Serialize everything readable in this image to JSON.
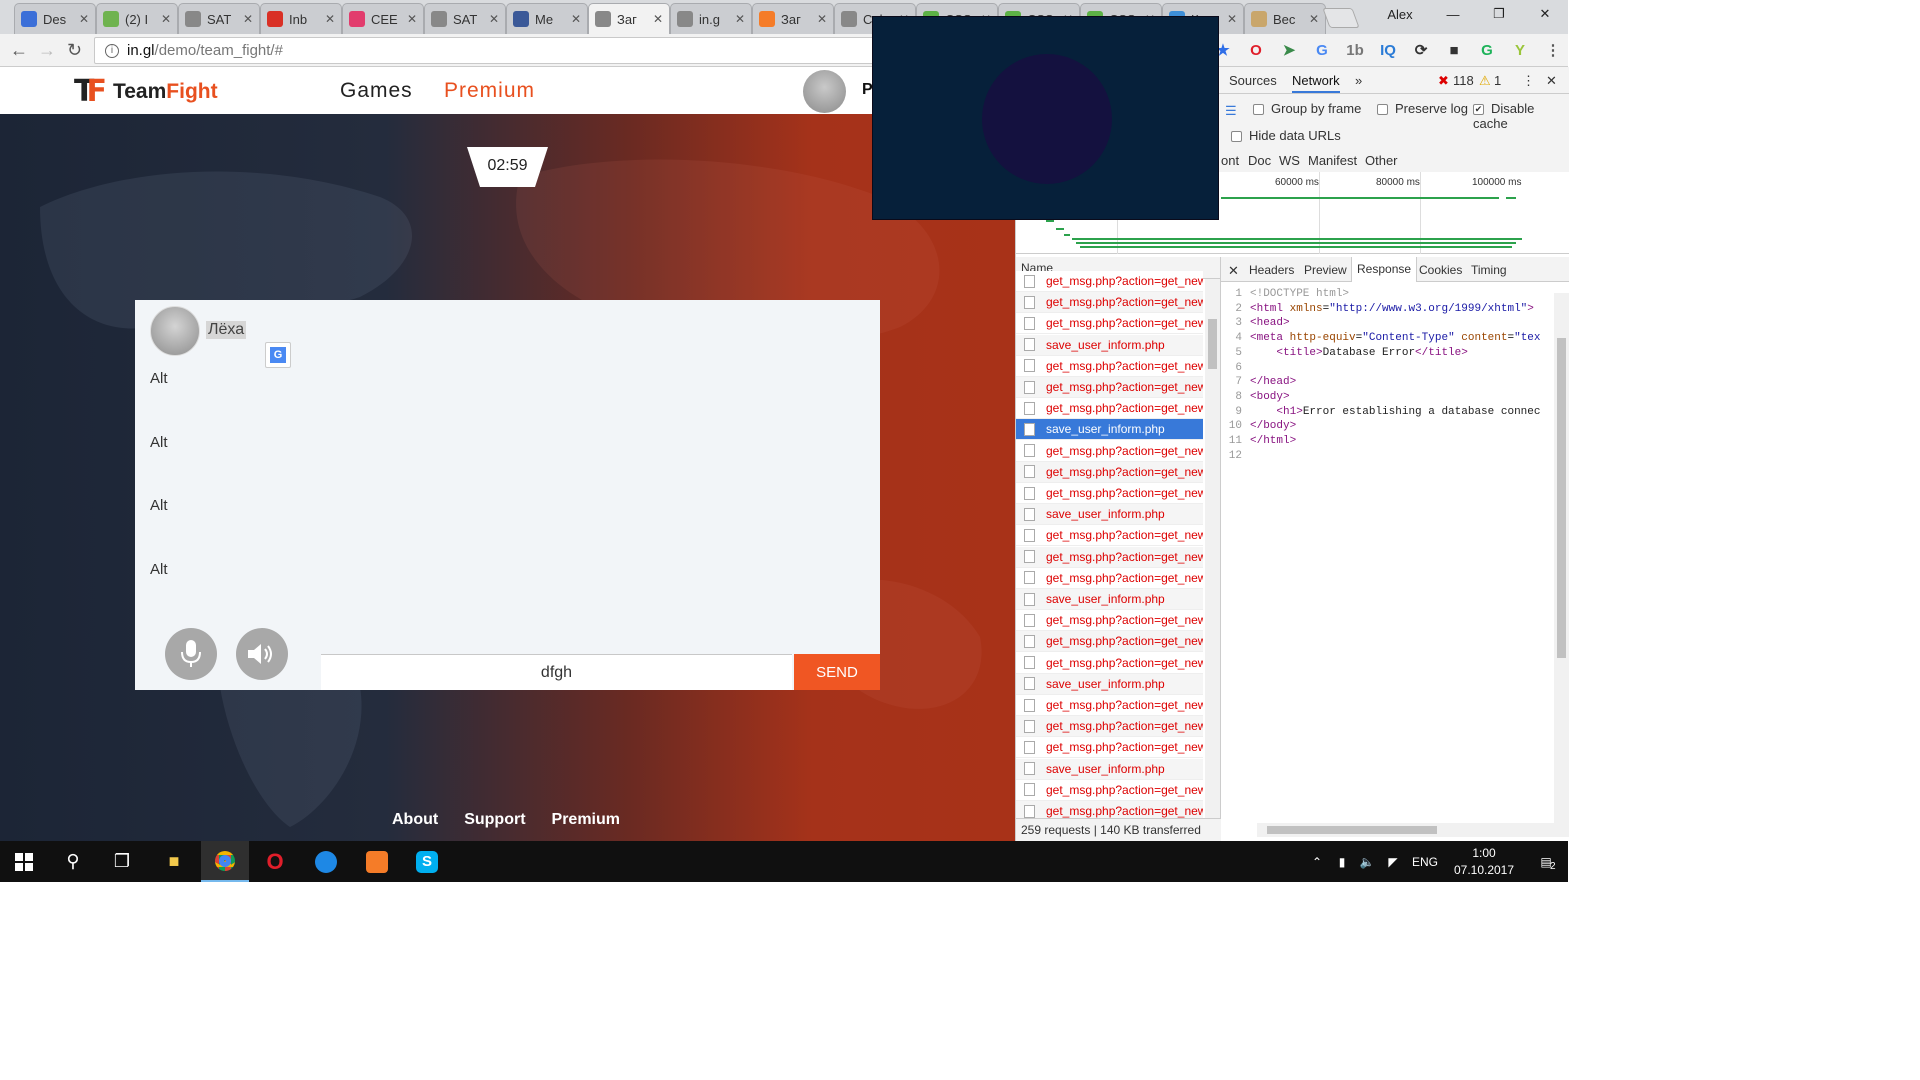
{
  "browser": {
    "tabs": [
      {
        "title": "Des",
        "icon": "q-icon",
        "color": "#3b6fd8"
      },
      {
        "title": "(2) I",
        "icon": "leaf-icon",
        "color": "#6fb34f"
      },
      {
        "title": "SAT",
        "icon": "doc-icon",
        "color": "#888888"
      },
      {
        "title": "Inb",
        "icon": "gmail-icon",
        "color": "#d93025"
      },
      {
        "title": "CEE",
        "icon": "cee-icon",
        "color": "#e23c6d"
      },
      {
        "title": "SAT",
        "icon": "doc-icon",
        "color": "#888888"
      },
      {
        "title": "Me",
        "icon": "facebook-icon",
        "color": "#3b5998"
      },
      {
        "title": "Заг",
        "icon": "doc-icon",
        "color": "#888888"
      },
      {
        "title": "in.g",
        "icon": "doc-icon",
        "color": "#888888"
      },
      {
        "title": "Заг",
        "icon": "xampp-icon",
        "color": "#f57c28"
      },
      {
        "title": "Cal",
        "icon": "doc-icon",
        "color": "#888888"
      },
      {
        "title": "CSS",
        "icon": "css-icon",
        "color": "#5db246"
      },
      {
        "title": "CSS",
        "icon": "css-icon",
        "color": "#5db246"
      },
      {
        "title": "CSS",
        "icon": "css-icon",
        "color": "#5db246"
      },
      {
        "title": "Кур",
        "icon": "kurs-icon",
        "color": "#3e8fd8"
      },
      {
        "title": "Вес",
        "icon": "weight-icon",
        "color": "#c9a66b"
      }
    ],
    "active_tab": 7,
    "profile_name": "Alex",
    "url_host": "in.gl",
    "url_path": "/demo/team_fight/#"
  },
  "site": {
    "logo_text_a": "Team",
    "logo_text_b": "Fight",
    "nav": [
      "Games",
      "Premium"
    ],
    "header_user_initial": "P",
    "timer": "02:59",
    "chat_user": "Лёха",
    "messages": [
      "Alt",
      "Alt",
      "Alt",
      "Alt"
    ],
    "input_value": "dfgh",
    "send_label": "SEND",
    "footer": [
      "About",
      "Support",
      "Premium"
    ],
    "colors": {
      "accent": "#f05623"
    }
  },
  "devtools": {
    "tabs": [
      "Sources",
      "Network"
    ],
    "active_tab": "Network",
    "errors": "118",
    "warnings": "1",
    "options": {
      "group_by_frame": "Group by frame",
      "preserve_log": "Preserve log",
      "disable_cache": "Disable cache",
      "hide_data_urls": "Hide data URLs"
    },
    "filters": [
      "ont",
      "Doc",
      "WS",
      "Manifest",
      "Other"
    ],
    "timeline_ticks": [
      "60000 ms",
      "80000 ms",
      "100000 ms"
    ],
    "name_header": "Name",
    "requests": [
      "get_msg.php?action=get_new",
      "get_msg.php?action=get_new",
      "get_msg.php?action=get_new",
      "save_user_inform.php",
      "get_msg.php?action=get_new",
      "get_msg.php?action=get_new",
      "get_msg.php?action=get_new",
      "save_user_inform.php",
      "get_msg.php?action=get_new",
      "get_msg.php?action=get_new",
      "get_msg.php?action=get_new",
      "save_user_inform.php",
      "get_msg.php?action=get_new",
      "get_msg.php?action=get_new",
      "get_msg.php?action=get_new",
      "save_user_inform.php",
      "get_msg.php?action=get_new",
      "get_msg.php?action=get_new",
      "get_msg.php?action=get_new",
      "save_user_inform.php",
      "get_msg.php?action=get_new",
      "get_msg.php?action=get_new",
      "get_msg.php?action=get_new",
      "save_user_inform.php",
      "get_msg.php?action=get_new",
      "get_msg.php?action=get_new"
    ],
    "selected_request": 7,
    "status": "259 requests | 140 KB transferred",
    "response_tabs": [
      "Headers",
      "Preview",
      "Response",
      "Cookies",
      "Timing"
    ],
    "active_response_tab": "Response",
    "code_lines": [
      "<!DOCTYPE html>",
      "<html xmlns=\"http://www.w3.org/1999/xhtml\">",
      "<head>",
      "<meta http-equiv=\"Content-Type\" content=\"tex",
      "    <title>Database Error</title>",
      "",
      "</head>",
      "<body>",
      "    <h1>Error establishing a database connec",
      "</body>",
      "</html>",
      ""
    ]
  },
  "taskbar": {
    "apps": [
      "windows-start-icon",
      "search-icon",
      "task-view-icon",
      "file-explorer-icon",
      "chrome-icon",
      "opera-icon",
      "app-blue-icon",
      "xampp-icon",
      "skype-icon"
    ],
    "language": "ENG",
    "time": "1:00",
    "date": "07.10.2017",
    "notification_count": "2"
  }
}
